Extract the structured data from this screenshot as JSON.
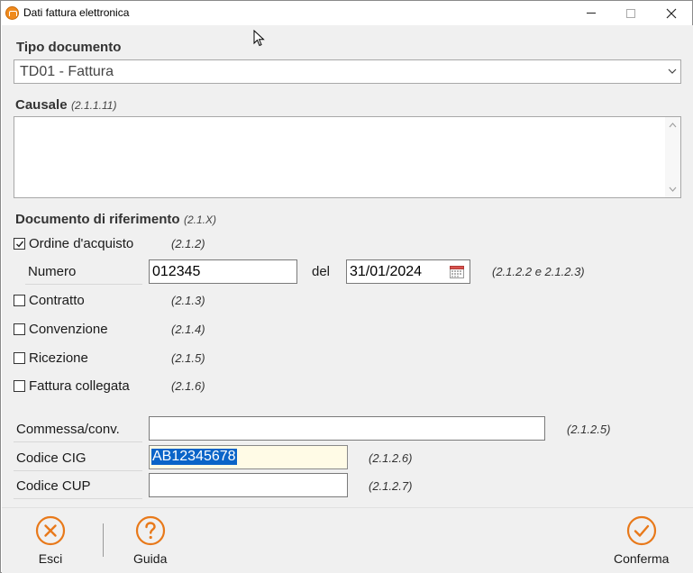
{
  "window": {
    "title": "Dati fattura elettronica",
    "icon": "app-logo-icon"
  },
  "tipo_documento": {
    "label": "Tipo documento",
    "selected": "TD01 - Fattura"
  },
  "causale": {
    "label": "Causale",
    "hint": "(2.1.1.11)",
    "value": ""
  },
  "documento_riferimento": {
    "label": "Documento di riferimento",
    "hint": "(2.1.X)",
    "ordine_acquisto": {
      "label": "Ordine d'acquisto",
      "code": "(2.1.2)",
      "checked": true,
      "numero_label": "Numero",
      "numero_value": "012345",
      "del_label": "del",
      "data_value": "31/01/2024",
      "fields_code": "(2.1.2.2 e 2.1.2.3)"
    },
    "contratto": {
      "label": "Contratto",
      "code": "(2.1.3)",
      "checked": false
    },
    "convenzione": {
      "label": "Convenzione",
      "code": "(2.1.4)",
      "checked": false
    },
    "ricezione": {
      "label": "Ricezione",
      "code": "(2.1.5)",
      "checked": false
    },
    "fattura_collegata": {
      "label": "Fattura collegata",
      "code": "(2.1.6)",
      "checked": false
    }
  },
  "commessa": {
    "label": "Commessa/conv.",
    "value": "",
    "code": "(2.1.2.5)"
  },
  "codice_cig": {
    "label": "Codice CIG",
    "value": "AB12345678",
    "code": "(2.1.2.6)"
  },
  "codice_cup": {
    "label": "Codice CUP",
    "value": "",
    "code": "(2.1.2.7)"
  },
  "footer": {
    "esci": "Esci",
    "guida": "Guida",
    "conferma": "Conferma"
  },
  "colors": {
    "accent": "#f08a1c",
    "selection": "#0a64c8",
    "panel": "#f0f0f0"
  }
}
